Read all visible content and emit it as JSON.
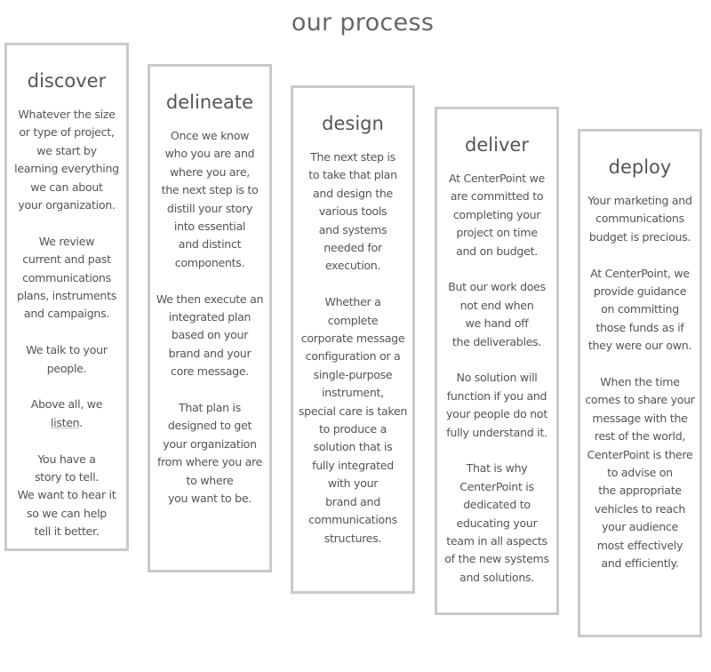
{
  "title": "our process",
  "colors": {
    "border": "#c9c9c9",
    "text": "#555555"
  },
  "steps": [
    {
      "heading": "discover",
      "underline": "listen",
      "paragraphs": [
        [
          "Whatever the size",
          "or type of project,",
          "we start by",
          "learning everything",
          "we can about",
          "your organization."
        ],
        [
          "We review",
          "current and past",
          "communications",
          "plans, instruments",
          "and campaigns."
        ],
        [
          "We talk to your",
          "people."
        ],
        [
          "Above all, we",
          "listen."
        ],
        [
          "You have a",
          "story to tell.",
          "We want to hear it",
          "so we can help",
          "tell it better."
        ]
      ]
    },
    {
      "heading": "delineate",
      "paragraphs": [
        [
          "Once we know",
          "who you are and",
          "where you are,",
          "the next step is to",
          "distill your story",
          "into essential",
          "and distinct",
          "components."
        ],
        [
          "We then execute an",
          "integrated plan",
          "based on your",
          "brand and your",
          "core message."
        ],
        [
          "That plan is",
          "designed to get",
          "your organization",
          "from where you are",
          "to where",
          "you want to be."
        ]
      ]
    },
    {
      "heading": "design",
      "paragraphs": [
        [
          "The next step is",
          "to take that plan",
          "and design the",
          "various tools",
          "and systems",
          "needed for",
          "execution."
        ],
        [
          "Whether a",
          "complete",
          "corporate message",
          "configuration or a",
          "single-purpose",
          "instrument,",
          "special care is taken",
          "to produce a",
          "solution that is",
          "fully integrated",
          "with your",
          "brand and",
          "communications",
          "structures."
        ]
      ]
    },
    {
      "heading": "deliver",
      "paragraphs": [
        [
          "At CenterPoint we",
          "are committed to",
          "completing your",
          "project on time",
          "and on budget."
        ],
        [
          "But our work does",
          "not end when",
          "we hand off",
          "the deliverables."
        ],
        [
          "No solution will",
          "function if you and",
          "your people do not",
          "fully understand it."
        ],
        [
          "That is why",
          "CenterPoint is",
          "dedicated to",
          "educating your",
          "team in all aspects",
          "of the new systems",
          "and solutions."
        ]
      ]
    },
    {
      "heading": "deploy",
      "paragraphs": [
        [
          "Your marketing and",
          "communications",
          "budget is precious."
        ],
        [
          "At CenterPoint, we",
          "provide guidance",
          "on committing",
          "those funds as if",
          "they were our own."
        ],
        [
          "When the time",
          "comes to share your",
          "message with the",
          "rest of the world,",
          "CenterPoint is there",
          "to advise on",
          "the appropriate",
          "vehicles to reach",
          "your audience",
          "most effectively",
          "and efficiently."
        ]
      ]
    }
  ]
}
